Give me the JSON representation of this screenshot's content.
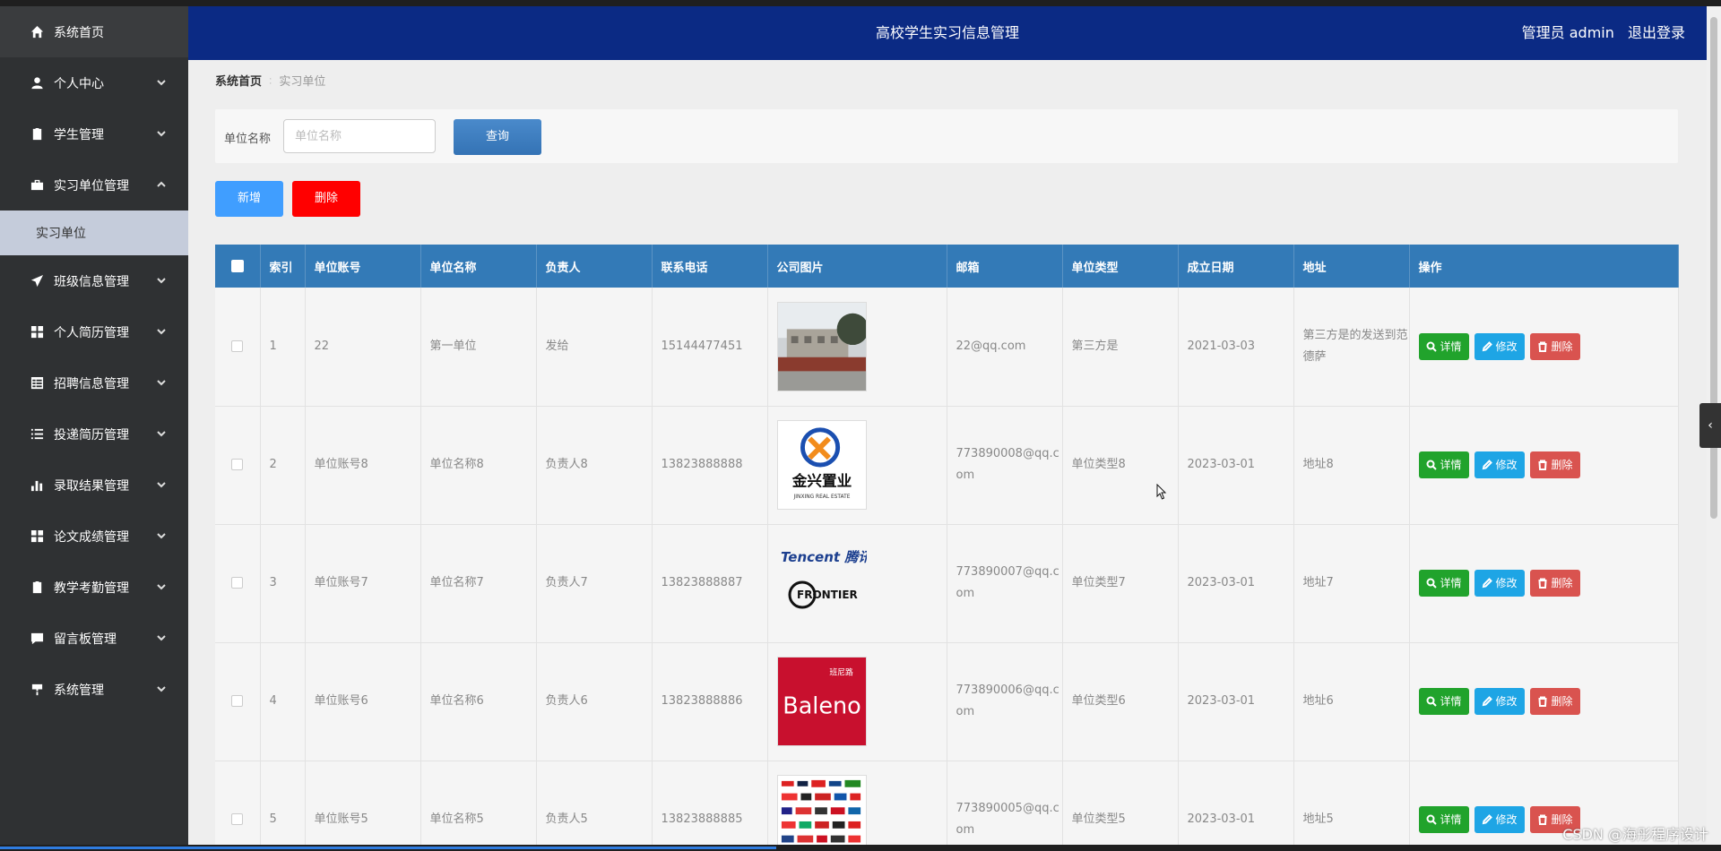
{
  "sidebar": {
    "items": [
      {
        "label": "系统首页",
        "icon": "home-icon"
      },
      {
        "label": "个人中心",
        "icon": "user-icon"
      },
      {
        "label": "学生管理",
        "icon": "clipboard-icon"
      },
      {
        "label": "实习单位管理",
        "icon": "briefcase-icon"
      },
      {
        "label": "班级信息管理",
        "icon": "send-icon"
      },
      {
        "label": "个人简历管理",
        "icon": "grid-icon"
      },
      {
        "label": "招聘信息管理",
        "icon": "table-icon"
      },
      {
        "label": "投递简历管理",
        "icon": "list-icon"
      },
      {
        "label": "录取结果管理",
        "icon": "bar-chart-icon"
      },
      {
        "label": "论文成绩管理",
        "icon": "grid-icon"
      },
      {
        "label": "教学考勤管理",
        "icon": "clipboard-check-icon"
      },
      {
        "label": "留言板管理",
        "icon": "comment-icon"
      },
      {
        "label": "系统管理",
        "icon": "cart-icon"
      }
    ],
    "sub_item": "实习单位"
  },
  "header": {
    "title": "高校学生实习信息管理",
    "user": "管理员 admin",
    "logout": "退出登录"
  },
  "breadcrumb": {
    "home": "系统首页",
    "current": "实习单位"
  },
  "search": {
    "label": "单位名称",
    "placeholder": "单位名称",
    "button": "查询"
  },
  "actions": {
    "add": "新增",
    "delete": "删除"
  },
  "table": {
    "columns": [
      "索引",
      "单位账号",
      "单位名称",
      "负责人",
      "联系电话",
      "公司图片",
      "邮箱",
      "单位类型",
      "成立日期",
      "地址",
      "操作"
    ],
    "rows": [
      {
        "index": "1",
        "account": "22",
        "name": "第一单位",
        "owner": "发给",
        "phone": "15144477451",
        "image": "building-photo",
        "email": "22@qq.com",
        "type": "第三方是",
        "date": "2021-03-03",
        "address": "第三方是的发送到范德萨"
      },
      {
        "index": "2",
        "account": "单位账号8",
        "name": "单位名称8",
        "owner": "负责人8",
        "phone": "13823888888",
        "image": "jinxing-logo",
        "email": "773890008@qq.com",
        "type": "单位类型8",
        "date": "2023-03-01",
        "address": "地址8"
      },
      {
        "index": "3",
        "account": "单位账号7",
        "name": "单位名称7",
        "owner": "负责人7",
        "phone": "13823888887",
        "image": "tencent-frontier-logo",
        "email": "773890007@qq.com",
        "type": "单位类型7",
        "date": "2023-03-01",
        "address": "地址7"
      },
      {
        "index": "4",
        "account": "单位账号6",
        "name": "单位名称6",
        "owner": "负责人6",
        "phone": "13823888886",
        "image": "baleno-logo",
        "email": "773890006@qq.com",
        "type": "单位类型6",
        "date": "2023-03-01",
        "address": "地址6"
      },
      {
        "index": "5",
        "account": "单位账号5",
        "name": "单位名称5",
        "owner": "负责人5",
        "phone": "13823888885",
        "image": "brand-collage",
        "email": "773890005@qq.com",
        "type": "单位类型5",
        "date": "2023-03-01",
        "address": "地址5"
      }
    ],
    "row_actions": {
      "detail": "详情",
      "edit": "修改",
      "remove": "删除"
    }
  },
  "logos": {
    "jinxing_cn": "金兴置业",
    "jinxing_en": "JINXING REAL ESTATE",
    "tencent": "Tencent 腾讯",
    "frontier": "FRONTIER",
    "baleno_cn": "班尼路",
    "baleno": "Baleno"
  },
  "watermark": "CSDN @海彤程序设计",
  "colors": {
    "header": "#0b2a84",
    "sidebar": "#2f3133",
    "table_header": "#337ab7",
    "add": "#409eff",
    "delete": "#ff0000",
    "detail": "#21a32c",
    "edit": "#1ea5e5",
    "remove": "#d9534f"
  }
}
